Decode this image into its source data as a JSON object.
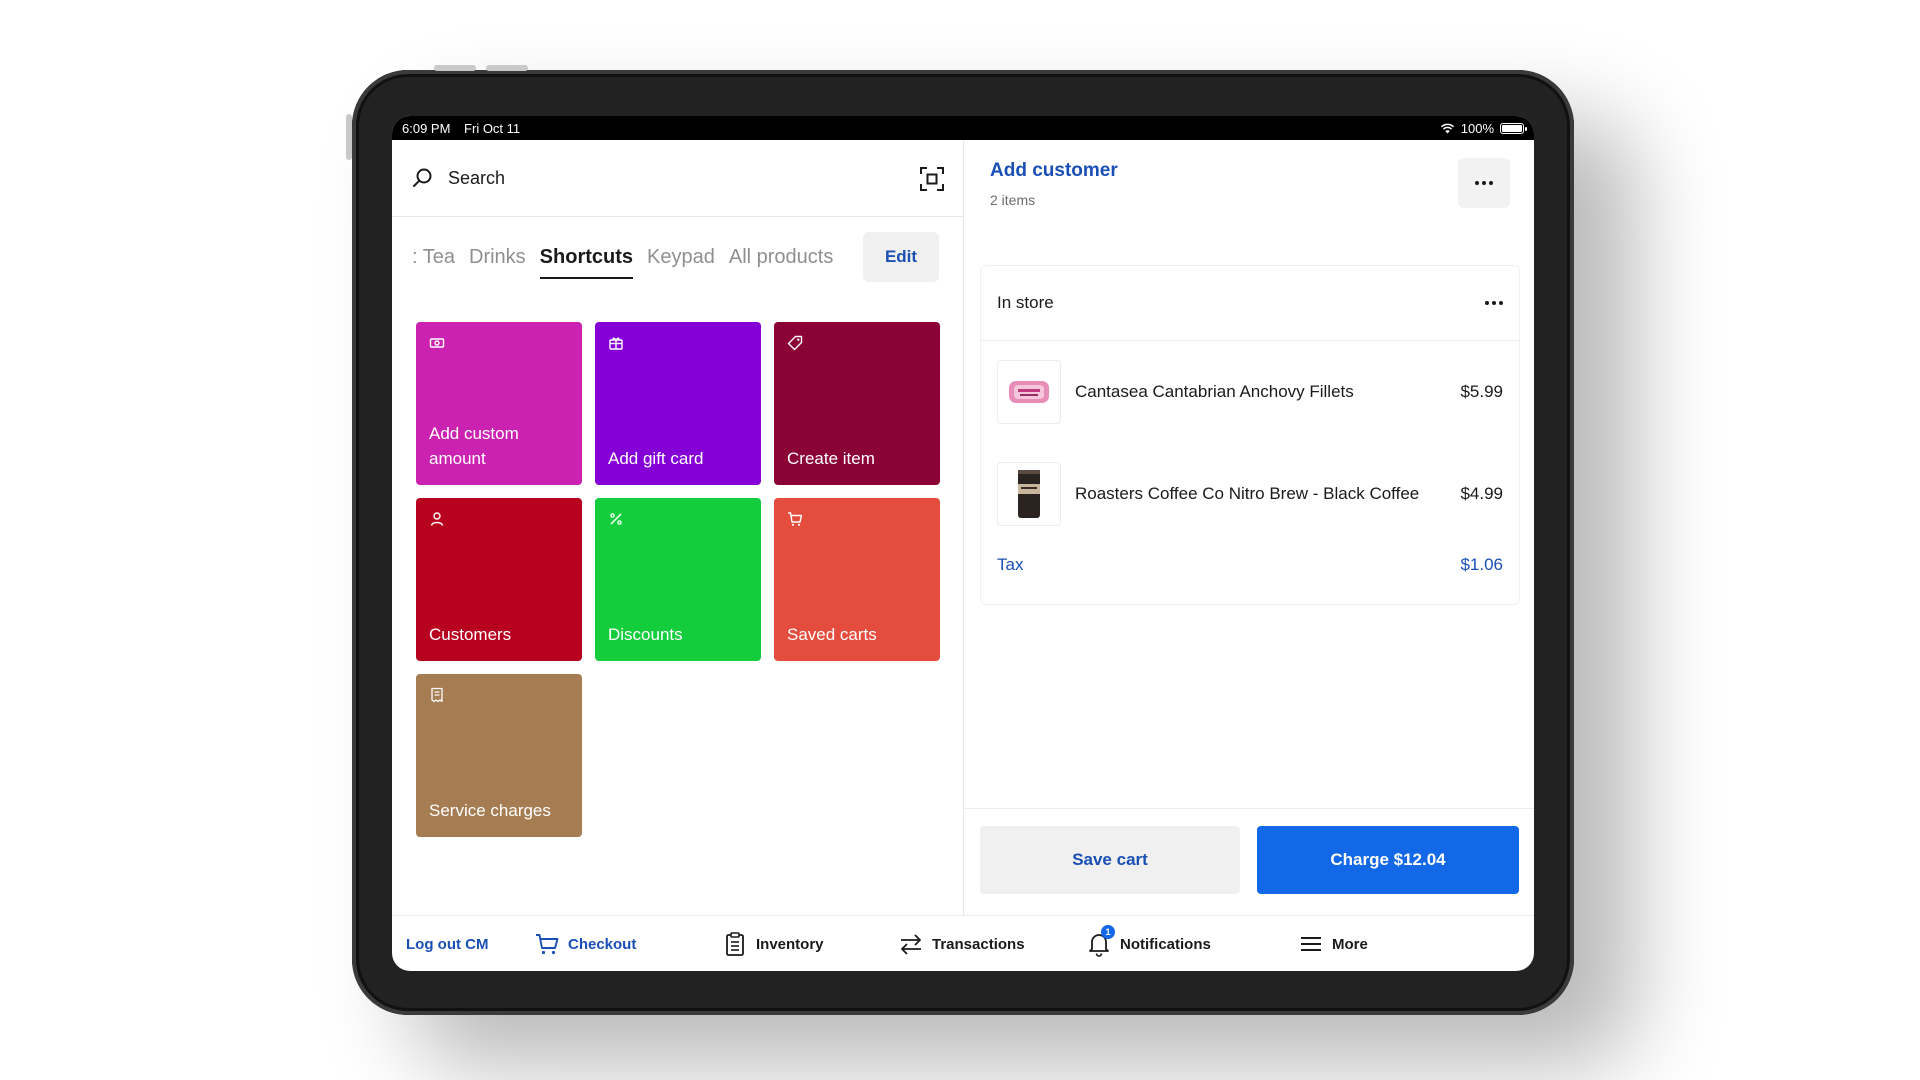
{
  "status_bar": {
    "time": "6:09 PM",
    "date": "Fri Oct 11",
    "battery": "100%"
  },
  "search": {
    "label": "Search"
  },
  "tabs": [
    {
      "label": ": Tea",
      "active": false
    },
    {
      "label": "Drinks",
      "active": false
    },
    {
      "label": "Shortcuts",
      "active": true
    },
    {
      "label": "Keypad",
      "active": false
    },
    {
      "label": "All products",
      "active": false
    }
  ],
  "edit_label": "Edit",
  "tiles": [
    {
      "label": "Add custom amount",
      "icon": "cash-icon",
      "color": "#cc22b2"
    },
    {
      "label": "Add gift card",
      "icon": "gift-icon",
      "color": "#8500d6"
    },
    {
      "label": "Create item",
      "icon": "tag-icon",
      "color": "#8a0236"
    },
    {
      "label": "Customers",
      "icon": "person-icon",
      "color": "#b8001f"
    },
    {
      "label": "Discounts",
      "icon": "percent-icon",
      "color": "#13cd3c"
    },
    {
      "label": "Saved carts",
      "icon": "cart-icon",
      "color": "#e44d3d"
    },
    {
      "label": "Service charges",
      "icon": "receipt-icon",
      "color": "#a67c52"
    }
  ],
  "cart": {
    "title": "Add customer",
    "item_count": "2 items",
    "section_label": "In store",
    "items": [
      {
        "name": "Cantasea Cantabrian Anchovy Fillets",
        "price": "$5.99",
        "thumb": "anchovy-tin"
      },
      {
        "name": "Roasters Coffee Co Nitro Brew - Black Coffee",
        "price": "$4.99",
        "thumb": "coffee-can"
      }
    ],
    "tax_label": "Tax",
    "tax_value": "$1.06",
    "save_label": "Save cart",
    "charge_label": "Charge $12.04"
  },
  "nav": {
    "logout": "Log out CM",
    "checkout": "Checkout",
    "inventory": "Inventory",
    "transactions": "Transactions",
    "notifications": "Notifications",
    "notification_count": "1",
    "more": "More"
  },
  "colors": {
    "accent": "#1a4fb5",
    "primary_button": "#1268e6"
  }
}
